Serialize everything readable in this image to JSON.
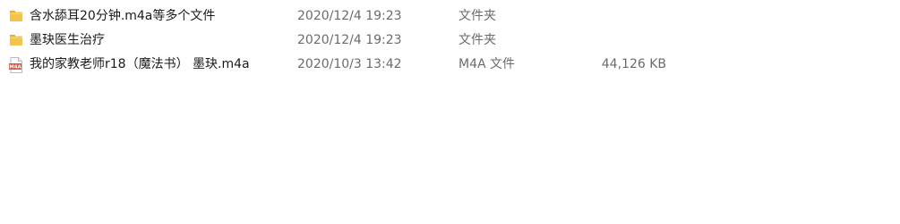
{
  "colors": {
    "folder_icon": "#f3c44b",
    "folder_icon_dark": "#e0a82e",
    "m4a_icon": "#e0543e",
    "text_primary": "#1a1a1a",
    "text_secondary": "#6b6b6b"
  },
  "files": [
    {
      "icon": "folder-icon",
      "name": "含水舔耳20分钟.m4a等多个文件",
      "date": "2020/12/4 19:23",
      "type": "文件夹",
      "size": ""
    },
    {
      "icon": "folder-icon",
      "name": "墨玦医生治疗",
      "date": "2020/12/4 19:23",
      "type": "文件夹",
      "size": ""
    },
    {
      "icon": "m4a-file-icon",
      "icon_text": "M4A",
      "name": "我的家教老师r18（魔法书） 墨玦.m4a",
      "date": "2020/10/3 13:42",
      "type": "M4A 文件",
      "size": "44,126 KB"
    }
  ]
}
